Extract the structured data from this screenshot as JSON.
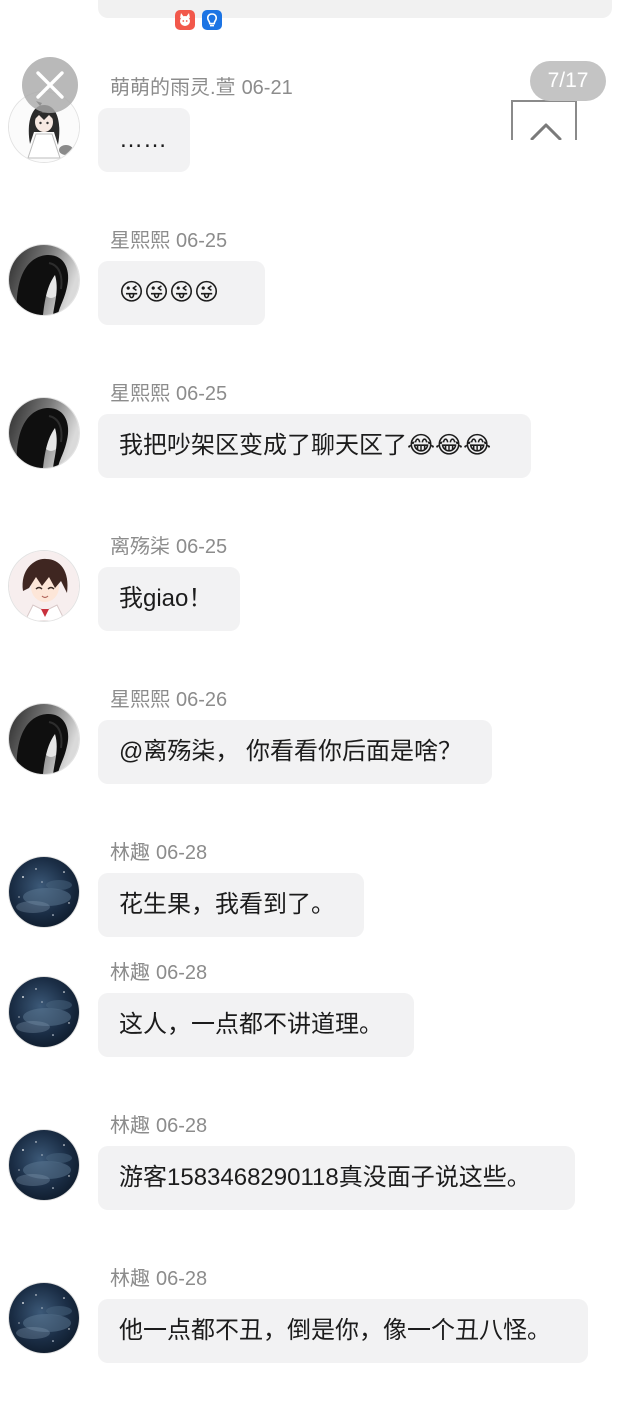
{
  "pager": {
    "indicator": "7/17"
  },
  "icons": {
    "close": "close-icon",
    "scroll_up": "chevron-up-icon",
    "top_app": "app-badge-icon",
    "top_bulb": "lightbulb-icon"
  },
  "messages": [
    {
      "name": "萌萌的雨灵.萱",
      "date": "06-21",
      "text": "……",
      "avatar": "anime-girl-avatar"
    },
    {
      "name": "星熙熙",
      "date": "06-25",
      "text": "😜😜😜😜",
      "avatar": "dark-hair-girl-avatar"
    },
    {
      "name": "星熙熙",
      "date": "06-25",
      "text": "我把吵架区变成了聊天区了😂😂😂",
      "avatar": "dark-hair-girl-avatar"
    },
    {
      "name": "离殇柒",
      "date": "06-25",
      "text": "我giao！",
      "avatar": "anime-boy-avatar"
    },
    {
      "name": "星熙熙",
      "date": "06-26",
      "text": "@离殇柒， 你看看你后面是啥？",
      "avatar": "dark-hair-girl-avatar"
    },
    {
      "name": "林趣",
      "date": "06-28",
      "text": "花生果，我看到了。",
      "avatar": "night-sky-avatar"
    },
    {
      "name": "林趣",
      "date": "06-28",
      "text": "这人，一点都不讲道理。",
      "avatar": "night-sky-avatar"
    },
    {
      "name": "林趣",
      "date": "06-28",
      "text": "游客1583468290118真没面子说这些。",
      "avatar": "night-sky-avatar"
    },
    {
      "name": "林趣",
      "date": "06-28",
      "text": "他一点都不丑，倒是你，像一个丑八怪。",
      "avatar": "night-sky-avatar"
    }
  ],
  "colors": {
    "bubble": "#f2f2f3",
    "meta": "#8c8c8c",
    "text": "#1c1c1c",
    "overlay": "#c4c4c4"
  }
}
